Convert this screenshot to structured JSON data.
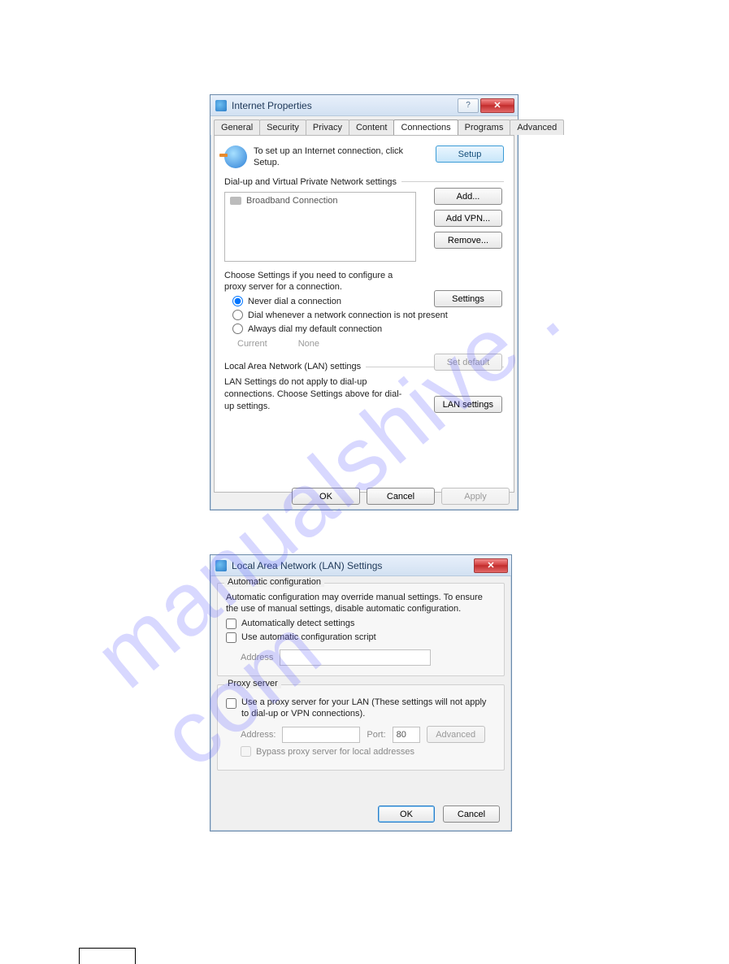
{
  "watermark": "manualshive . com",
  "dlg1": {
    "title": "Internet Properties",
    "help_aria": "Help",
    "close_aria": "Close",
    "tabs": [
      "General",
      "Security",
      "Privacy",
      "Content",
      "Connections",
      "Programs",
      "Advanced"
    ],
    "intro": "To set up an Internet connection, click Setup.",
    "setup_btn": "Setup",
    "group_dialup": "Dial-up and Virtual Private Network settings",
    "conn_item": "Broadband Connection",
    "add_btn": "Add...",
    "addvpn_btn": "Add VPN...",
    "remove_btn": "Remove...",
    "choose_text": "Choose Settings if you need to configure a proxy server for a connection.",
    "settings_btn": "Settings",
    "radio_never": "Never dial a connection",
    "radio_whenever": "Dial whenever a network connection is not present",
    "radio_always": "Always dial my default connection",
    "current_label": "Current",
    "current_value": "None",
    "setdefault_btn": "Set default",
    "group_lan": "Local Area Network (LAN) settings",
    "lan_note": "LAN Settings do not apply to dial-up connections. Choose Settings above for dial-up settings.",
    "lan_btn": "LAN settings",
    "ok_btn": "OK",
    "cancel_btn": "Cancel",
    "apply_btn": "Apply"
  },
  "dlg2": {
    "title": "Local Area Network (LAN) Settings",
    "close_aria": "Close",
    "group_auto": "Automatic configuration",
    "auto_note": "Automatic configuration may override manual settings.  To ensure the use of manual settings, disable automatic configuration.",
    "chk_auto_detect": "Automatically detect settings",
    "chk_auto_script": "Use automatic configuration script",
    "auto_addr_label": "Address",
    "group_proxy": "Proxy server",
    "chk_proxy": "Use a proxy server for your LAN (These settings will not apply to dial-up or VPN connections).",
    "proxy_addr_label": "Address:",
    "proxy_port_label": "Port:",
    "proxy_port_value": "80",
    "advanced_btn": "Advanced",
    "chk_bypass": "Bypass proxy server for local addresses",
    "ok_btn": "OK",
    "cancel_btn": "Cancel"
  }
}
